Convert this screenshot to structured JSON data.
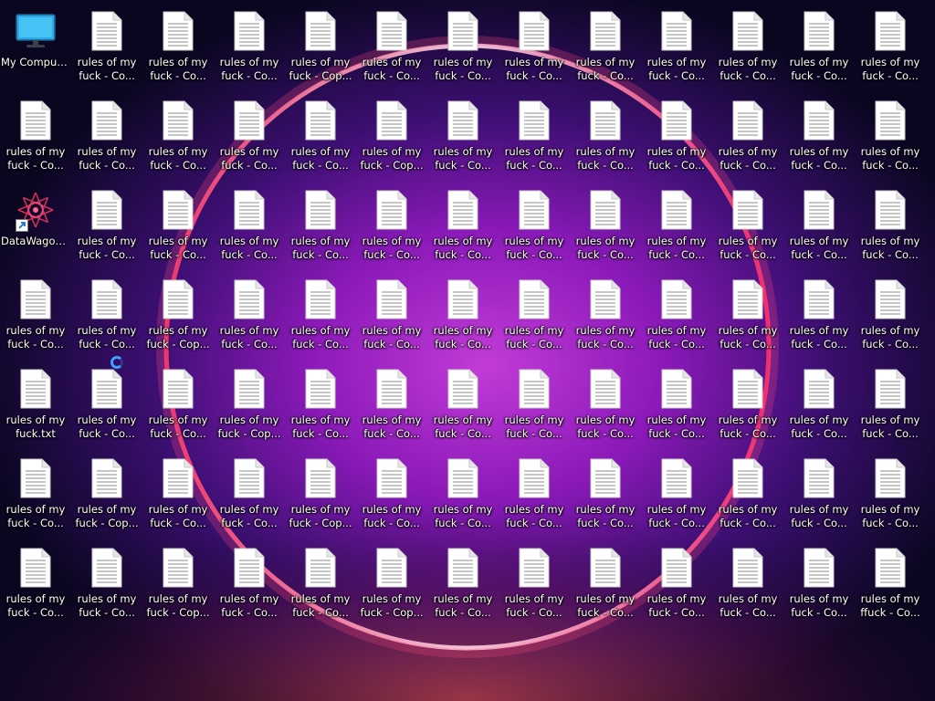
{
  "desktop": {
    "special_icons": [
      {
        "name": "my-computer-icon",
        "label_line1": "My Computer",
        "label_line2": "",
        "cell": [
          0,
          0
        ]
      },
      {
        "name": "datawagon-shortcut-icon",
        "label_line1": "DataWagon...",
        "label_line2": "",
        "cell": [
          2,
          0
        ]
      },
      {
        "name": "text-file-icon",
        "label_line1": "rules of my",
        "label_line2": "fuck.txt",
        "cell": [
          4,
          0
        ]
      }
    ],
    "grid": {
      "rows": 7,
      "cols": 13,
      "default_line1": "rules of my",
      "default_line2": "fuck - Co...",
      "alt_line2": "fuck - Cop...",
      "last_cell_line1": "rules of my",
      "last_cell_line2": "ffuck - Co...",
      "cop_cells": [
        [
          0,
          4
        ],
        [
          1,
          5
        ],
        [
          3,
          2
        ],
        [
          4,
          3
        ],
        [
          5,
          1
        ],
        [
          5,
          4
        ],
        [
          6,
          2
        ],
        [
          6,
          5
        ]
      ]
    }
  },
  "colors": {
    "accent_ring": "#3ea0ff",
    "background": "#0b0820"
  }
}
